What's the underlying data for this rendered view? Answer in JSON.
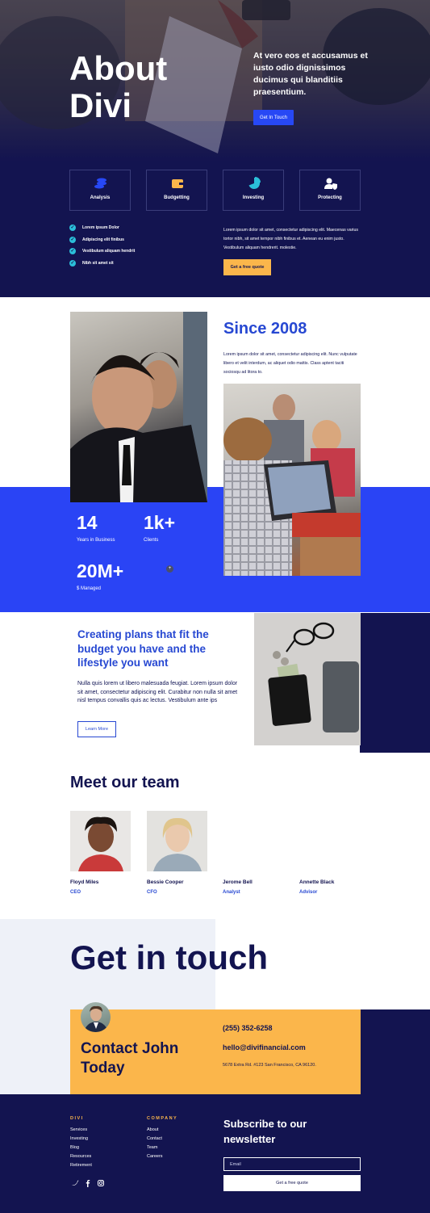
{
  "hero": {
    "title": "About Divi",
    "text": "At vero eos et accusamus et iusto odio dignissimos ducimus qui blanditiis praesentium.",
    "button_label": "Get In Touch"
  },
  "services": [
    {
      "label": "Analysis",
      "icon": "coins-icon"
    },
    {
      "label": "Budgetting",
      "icon": "wallet-icon"
    },
    {
      "label": "Investing",
      "icon": "pie-chart-icon"
    },
    {
      "label": "Protecting",
      "icon": "user-shield-icon"
    }
  ],
  "checklist": [
    "Lorem ipsum Dolor",
    "Adipiscing elit finibus",
    "Vestibulum aliquam hendrit",
    "Nibh sit amet sit"
  ],
  "hero_paragraph": "Lorem ipsum dolor sit amet, consectetur adipiscing elit. Maecenas varius tortor nibh, sit amet tempor nibh finibus et. Aenean eu enim justo. Vestibulum aliquam hendrerit. molestie.",
  "quote_button": "Get a free quote",
  "since": {
    "title": "Since 2008",
    "text": "Lorem ipsum dolor sit amet, consectetur adipiscing elit. Nunc vulputate libero et velit interdum, ac aliquet odio mattis. Class aptent taciti sociosqu ad litora to."
  },
  "stats": [
    {
      "value": "14",
      "label": "Years in Business"
    },
    {
      "value": "1k+",
      "label": "Clients"
    },
    {
      "value": "20M+",
      "label": "$ Managed"
    }
  ],
  "plans": {
    "title": "Creating plans that fit the budget you have and the lifestyle you want",
    "text": "Nulla quis lorem ut libero malesuada feugiat. Lorem ipsum dolor sit amet, consectetur adipiscing elit. Curabitur non nulla sit amet nisl tempus convallis quis ac lectus. Vestibulum ante ips",
    "button_label": "Learn More"
  },
  "team": {
    "title": "Meet our team",
    "members": [
      {
        "name": "Floyd Miles",
        "role": "CEO"
      },
      {
        "name": "Bessie Cooper",
        "role": "CFO"
      },
      {
        "name": "Jerome Bell",
        "role": "Analyst"
      },
      {
        "name": "Annette Black",
        "role": "Advisor"
      }
    ]
  },
  "contact": {
    "title": "Get in touch",
    "card_title": "Contact John Today",
    "phone": "(255) 352-6258",
    "email": "hello@divifinancial.com",
    "address": "5678 Extra Rd. #123 San Francisco, CA 96120."
  },
  "footer": {
    "col1_head": "DIVI",
    "col1_links": [
      "Services",
      "Investing",
      "Blog",
      "Resources",
      "Retirement"
    ],
    "col2_head": "COMPANY",
    "col2_links": [
      "About",
      "Contact",
      "Team",
      "Careers"
    ],
    "subscribe_title": "Subscribe to our newsletter",
    "email_placeholder": "Email",
    "button_label": "Get a free quote",
    "social": [
      "twitter-icon",
      "facebook-icon",
      "instagram-icon"
    ]
  },
  "colors": {
    "navy": "#131450",
    "blue": "#2a44f5",
    "accent_blue_text": "#2748d2",
    "yellow": "#fbb64b",
    "teal": "#2bbfd9",
    "light_gray": "#eef1f8"
  }
}
